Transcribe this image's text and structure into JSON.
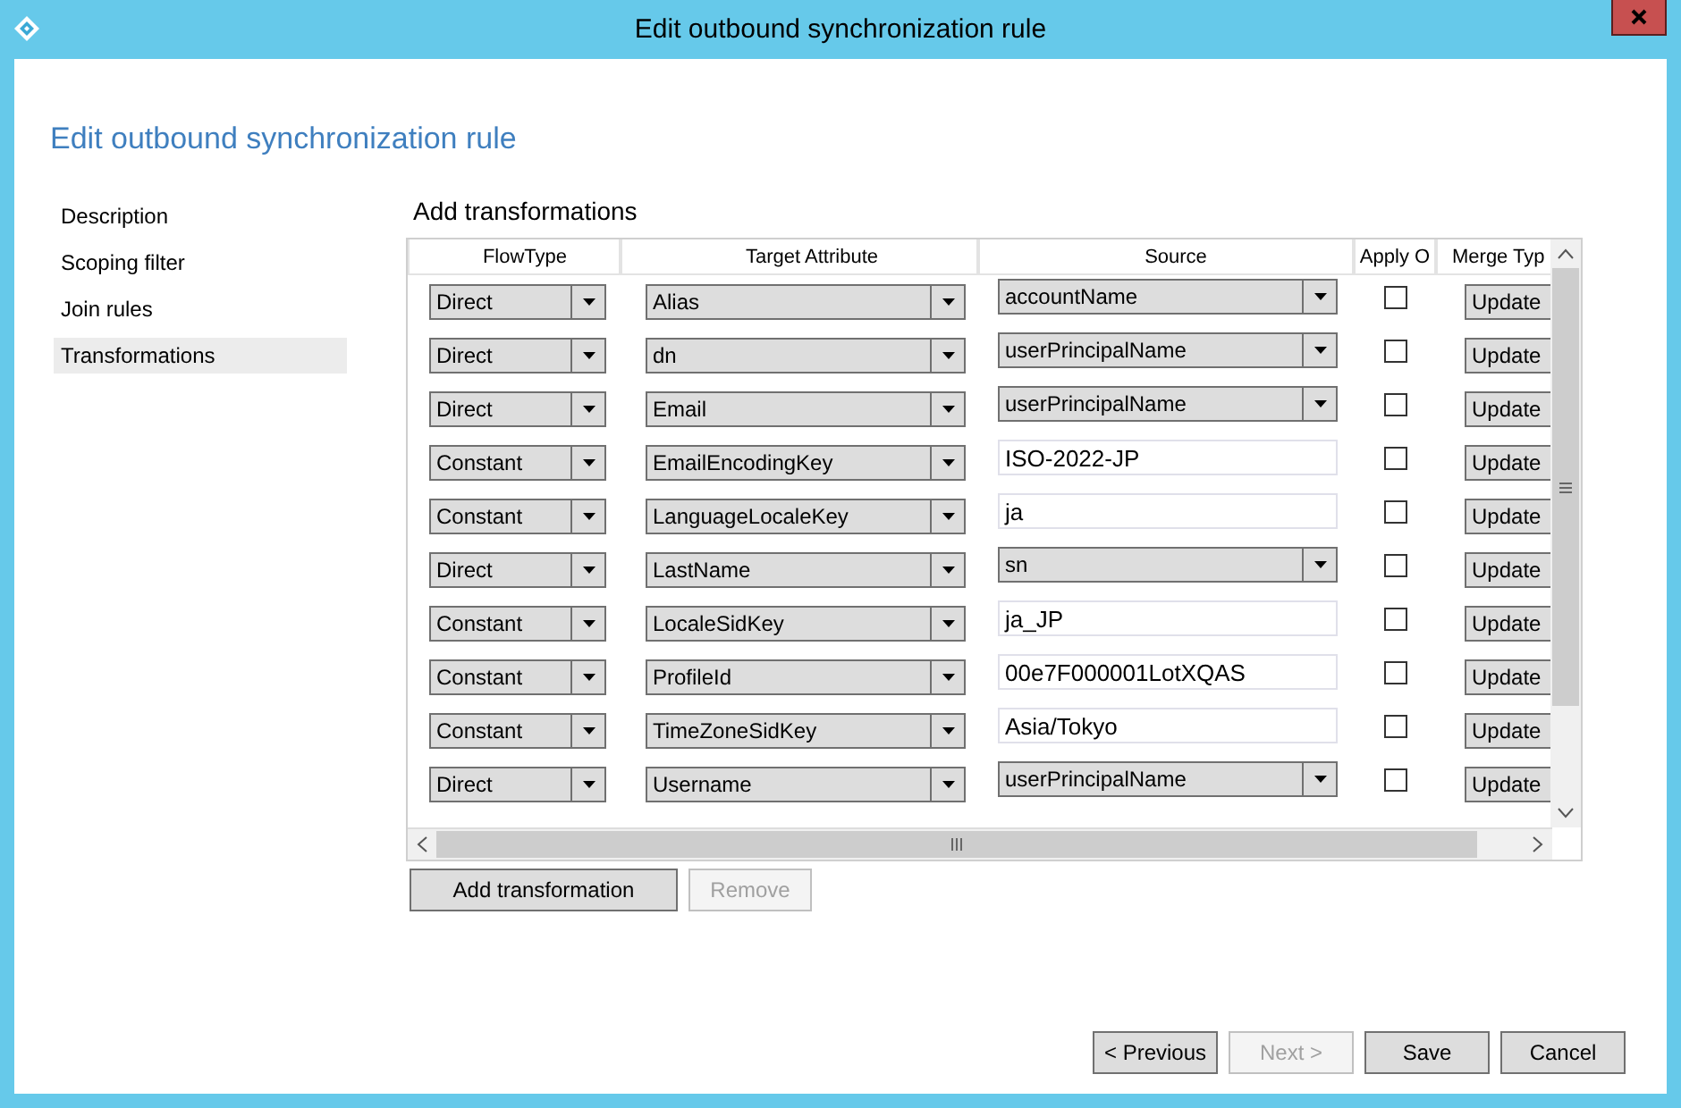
{
  "window": {
    "title": "Edit outbound synchronization rule"
  },
  "heading": "Edit outbound synchronization rule",
  "sidebar": {
    "items": [
      {
        "label": "Description",
        "selected": false
      },
      {
        "label": "Scoping filter",
        "selected": false
      },
      {
        "label": "Join rules",
        "selected": false
      },
      {
        "label": "Transformations",
        "selected": true
      }
    ]
  },
  "section_title": "Add transformations",
  "table": {
    "columns": [
      "FlowType",
      "Target Attribute",
      "Source",
      "Apply O",
      "Merge Typ"
    ],
    "rows": [
      {
        "flow_type": "Direct",
        "target_attribute": "Alias",
        "source": "accountName",
        "kind": "dropdown",
        "apply_once": false,
        "merge_type": "Update"
      },
      {
        "flow_type": "Direct",
        "target_attribute": "dn",
        "source": "userPrincipalName",
        "kind": "dropdown",
        "apply_once": false,
        "merge_type": "Update"
      },
      {
        "flow_type": "Direct",
        "target_attribute": "Email",
        "source": "userPrincipalName",
        "kind": "dropdown",
        "apply_once": false,
        "merge_type": "Update"
      },
      {
        "flow_type": "Constant",
        "target_attribute": "EmailEncodingKey",
        "source": "ISO-2022-JP",
        "kind": "text",
        "apply_once": false,
        "merge_type": "Update"
      },
      {
        "flow_type": "Constant",
        "target_attribute": "LanguageLocaleKey",
        "source": "ja",
        "kind": "text",
        "apply_once": false,
        "merge_type": "Update"
      },
      {
        "flow_type": "Direct",
        "target_attribute": "LastName",
        "source": "sn",
        "kind": "dropdown",
        "apply_once": false,
        "merge_type": "Update"
      },
      {
        "flow_type": "Constant",
        "target_attribute": "LocaleSidKey",
        "source": "ja_JP",
        "kind": "text",
        "apply_once": false,
        "merge_type": "Update"
      },
      {
        "flow_type": "Constant",
        "target_attribute": "ProfileId",
        "source": "00e7F000001LotXQAS",
        "kind": "text",
        "apply_once": false,
        "merge_type": "Update"
      },
      {
        "flow_type": "Constant",
        "target_attribute": "TimeZoneSidKey",
        "source": "Asia/Tokyo",
        "kind": "text",
        "apply_once": false,
        "merge_type": "Update"
      },
      {
        "flow_type": "Direct",
        "target_attribute": "Username",
        "source": "userPrincipalName",
        "kind": "dropdown",
        "apply_once": false,
        "merge_type": "Update"
      }
    ]
  },
  "table_buttons": [
    {
      "label": "Add transformation",
      "disabled": false
    },
    {
      "label": "Remove",
      "disabled": true
    }
  ],
  "footer_buttons": [
    {
      "label": "< Previous",
      "disabled": false
    },
    {
      "label": "Next >",
      "disabled": true
    },
    {
      "label": "Save",
      "disabled": false
    },
    {
      "label": "Cancel",
      "disabled": false
    }
  ]
}
